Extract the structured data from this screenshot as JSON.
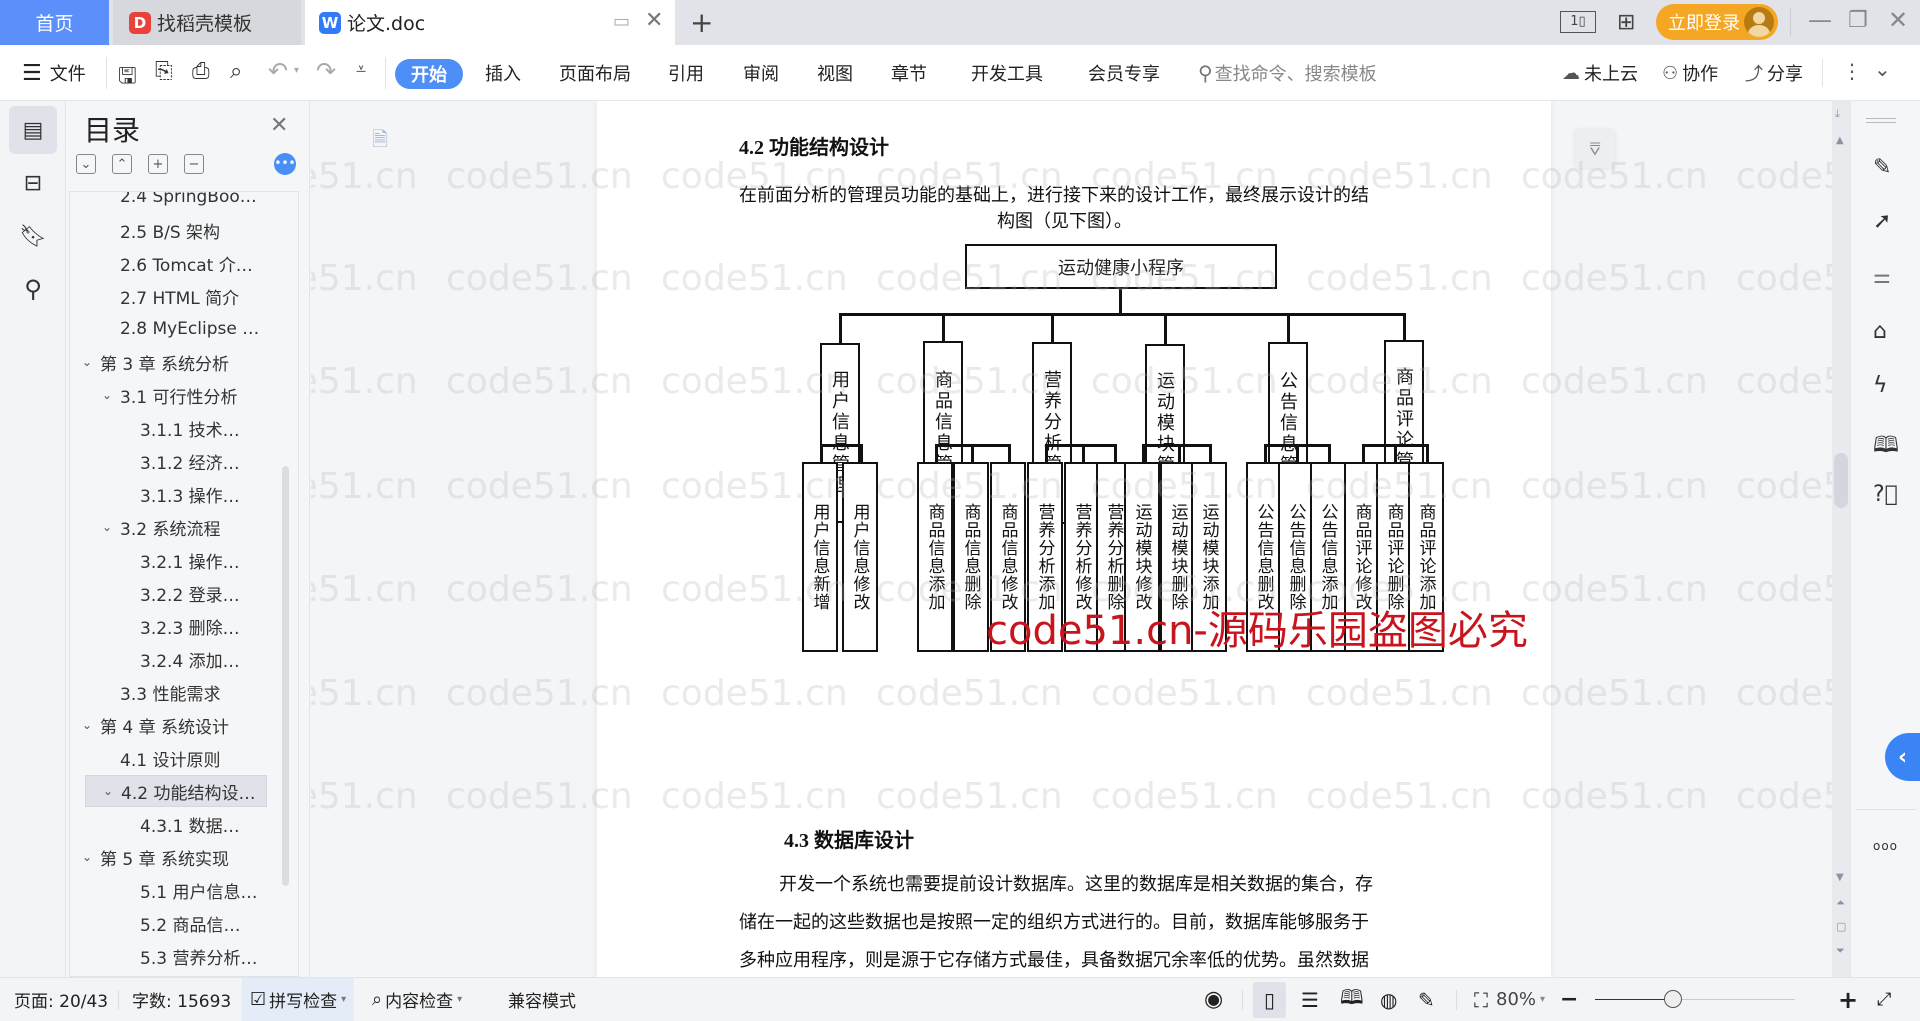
{
  "tabs": {
    "home": "首页",
    "docer": "找稻壳模板",
    "doc": "论文.doc",
    "new_tab": "+"
  },
  "titlebar": {
    "login": "立即登录"
  },
  "toolbar": {
    "file": "文件",
    "menu_tabs": [
      "开始",
      "插入",
      "页面布局",
      "引用",
      "审阅",
      "视图",
      "章节",
      "开发工具",
      "会员专享"
    ],
    "search_placeholder": "查找命令、搜索模板",
    "cloud": "未上云",
    "collab": "协作",
    "share": "分享"
  },
  "toc": {
    "title": "目录",
    "items": [
      {
        "label": "2.4 SpringBoo…",
        "level": 2
      },
      {
        "label": "2.5 B/S 架构",
        "level": 2
      },
      {
        "label": "2.6 Tomcat 介…",
        "level": 2
      },
      {
        "label": "2.7 HTML 简介",
        "level": 2
      },
      {
        "label": "2.8 MyEclipse …",
        "level": 2
      },
      {
        "label": "第 3 章  系统分析",
        "level": 1,
        "expanded": true
      },
      {
        "label": "3.1  可行性分析",
        "level": 2,
        "expanded": true
      },
      {
        "label": "3.1.1  技术…",
        "level": 3
      },
      {
        "label": "3.1.2  经济…",
        "level": 3
      },
      {
        "label": "3.1.3  操作…",
        "level": 3
      },
      {
        "label": "3.2  系统流程",
        "level": 2,
        "expanded": true
      },
      {
        "label": "3.2.1  操作…",
        "level": 3
      },
      {
        "label": "3.2.2  登录…",
        "level": 3
      },
      {
        "label": "3.2.3  删除…",
        "level": 3
      },
      {
        "label": "3.2.4  添加…",
        "level": 3
      },
      {
        "label": "3.3  性能需求",
        "level": 2
      },
      {
        "label": "第 4 章  系统设计",
        "level": 1,
        "expanded": true
      },
      {
        "label": "4.1  设计原则",
        "level": 2
      },
      {
        "label": "4.2  功能结构设…",
        "level": 2,
        "expanded": true,
        "selected": true
      },
      {
        "label": "4.3.1  数据…",
        "level": 3
      },
      {
        "label": "第 5 章  系统实现",
        "level": 1,
        "expanded": true
      },
      {
        "label": "5.1 用户信息…",
        "level": 3
      },
      {
        "label": "5.2  商品信…",
        "level": 3
      },
      {
        "label": "5.3 营养分析…",
        "level": 3
      }
    ]
  },
  "document": {
    "heading_42": "4.2  功能结构设计",
    "intro_line1": "在前面分析的管理员功能的基础上，进行接下来的设计工作，最终展示设计的结",
    "intro_line2": "构图（见下图）。",
    "diagram": {
      "root": "运动健康小程序",
      "modules": [
        {
          "name": "用户信息管理",
          "children": [
            "用户信息新增",
            "用户信息修改"
          ]
        },
        {
          "name": "商品信息管理",
          "children": [
            "商品信息添加",
            "商品信息删除",
            "商品信息修改"
          ]
        },
        {
          "name": "营养分析管理",
          "children": [
            "营养分析添加",
            "营养分析修改",
            "营养分析删除"
          ]
        },
        {
          "name": "运动模块管理",
          "children": [
            "运动模块修改",
            "运动模块删除",
            "运动模块添加"
          ]
        },
        {
          "name": "公告信息管理",
          "children": [
            "公告信息删改",
            "公告信息删除",
            "公告信息添加"
          ]
        },
        {
          "name": "商品评论管理",
          "children": [
            "商品评论修改",
            "商品评论删除",
            "商品评论添加"
          ]
        }
      ]
    },
    "overlay_watermark": "code51.cn-源码乐园盗图必究",
    "bg_watermark": "code51.cn",
    "heading_43": "4.3  数据库设计",
    "db_para": [
      "开发一个系统也需要提前设计数据库。这里的数据库是相关数据的集合，存",
      "储在一起的这些数据也是按照一定的组织方式进行的。目前，数据库能够服务于",
      "多种应用程序，则是源于它存储方式最佳，具备数据冗余率低的优势。虽然数据"
    ]
  },
  "statusbar": {
    "page": "页面: 20/43",
    "words": "字数: 15693",
    "spell_check": "拼写检查",
    "content_check": "内容检查",
    "compat_mode": "兼容模式",
    "zoom_label": "80%",
    "zoom_percent": 80
  },
  "colors": {
    "accent": "#4e8ef7",
    "home_tab": "#5b8ff9",
    "login": "#f5a623",
    "red_watermark": "#c8141c"
  }
}
